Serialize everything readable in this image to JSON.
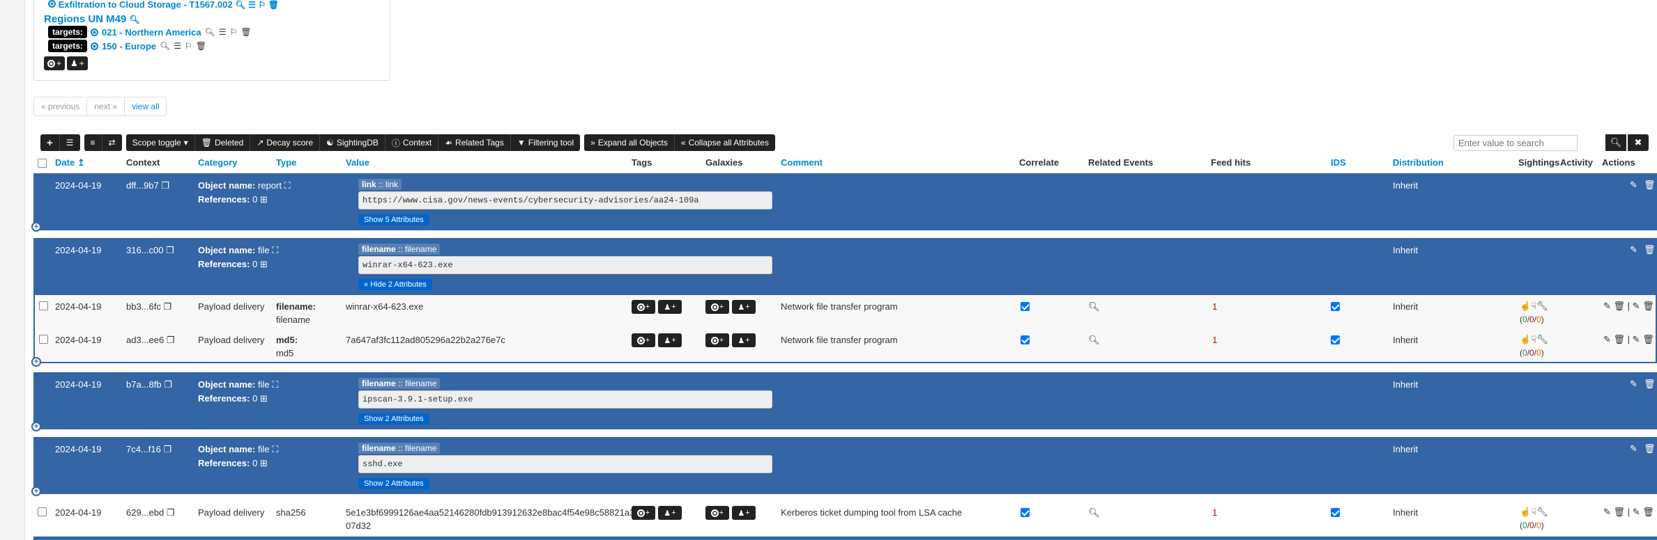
{
  "galaxy_box": {
    "cut_line": "Exfiltration to Cloud Storage - T1567.002",
    "title": "Regions UN M49",
    "targets_label": "targets:",
    "targets": [
      {
        "name": "021 - Northern America"
      },
      {
        "name": "150 - Europe"
      }
    ]
  },
  "pagination": {
    "prev": "« previous",
    "next": "next »",
    "view_all": "view all"
  },
  "toolbar": {
    "scope_toggle": "Scope toggle",
    "deleted": "Deleted",
    "decay_score": "Decay score",
    "sightingdb": "SightingDB",
    "context": "Context",
    "related_tags": "Related Tags",
    "filtering_tool": "Filtering tool",
    "expand_all": "Expand all Objects",
    "collapse_all": "Collapse all Attributes"
  },
  "search": {
    "placeholder": "Enter value to search"
  },
  "columns": {
    "date": "Date",
    "context": "Context",
    "category": "Category",
    "type": "Type",
    "value": "Value",
    "tags": "Tags",
    "galaxies": "Galaxies",
    "comment": "Comment",
    "correlate": "Correlate",
    "related_events": "Related Events",
    "feed_hits": "Feed hits",
    "ids": "IDS",
    "distribution": "Distribution",
    "sightings": "Sightings",
    "activity": "Activity",
    "actions": "Actions"
  },
  "objects": [
    {
      "date": "2024-04-19",
      "uuid": "dff...9b7",
      "object_name_label": "Object name:",
      "object_name": "report",
      "references_label": "References:",
      "references": "0",
      "rel_name": "link",
      "rel_sep": " :: ",
      "rel_type": "link",
      "value": "https://www.cisa.gov/news-events/cybersecurity-advisories/aa24-109a",
      "toggle": "Show 5 Attributes",
      "distribution": "Inherit"
    },
    {
      "date": "2024-04-19",
      "uuid": "316...c00",
      "object_name_label": "Object name:",
      "object_name": "file",
      "references_label": "References:",
      "references": "0",
      "rel_name": "filename",
      "rel_sep": " :: ",
      "rel_type": "filename",
      "value": "winrar-x64-623.exe",
      "toggle": "Hide 2 Attributes",
      "distribution": "Inherit"
    },
    {
      "date": "2024-04-19",
      "uuid": "b7a...8fb",
      "object_name_label": "Object name:",
      "object_name": "file",
      "references_label": "References:",
      "references": "0",
      "rel_name": "filename",
      "rel_sep": " :: ",
      "rel_type": "filename",
      "value": "ipscan-3.9.1-setup.exe",
      "toggle": "Show 2 Attributes",
      "distribution": "Inherit"
    },
    {
      "date": "2024-04-19",
      "uuid": "7c4...f16",
      "object_name_label": "Object name:",
      "object_name": "file",
      "references_label": "References:",
      "references": "0",
      "rel_name": "filename",
      "rel_sep": " :: ",
      "rel_type": "filename",
      "value": "sshd.exe",
      "toggle": "Show 2 Attributes",
      "distribution": "Inherit"
    }
  ],
  "attributes": [
    {
      "date": "2024-04-19",
      "uuid": "bb3...6fc",
      "category": "Payload delivery",
      "type_rel": "filename:",
      "type": "filename",
      "value": "winrar-x64-623.exe",
      "comment": "Network file transfer program",
      "feed_hits": "1",
      "distribution": "Inherit",
      "sightings_open": "(",
      "s_pos": "0",
      "slash1": "/",
      "s_neg": "0",
      "slash2": "/",
      "s_exp": "0",
      "sightings_close": ")"
    },
    {
      "date": "2024-04-19",
      "uuid": "ad3...ee6",
      "category": "Payload delivery",
      "type_rel": "md5:",
      "type": "md5",
      "value": "7a647af3fc112ad805296a22b2a276e7c",
      "comment": "Network file transfer program",
      "feed_hits": "1",
      "distribution": "Inherit",
      "sightings_open": "(",
      "s_pos": "0",
      "slash1": "/",
      "s_neg": "0",
      "slash2": "/",
      "s_exp": "0",
      "sightings_close": ")"
    },
    {
      "date": "2024-04-19",
      "uuid": "629...ebd",
      "category": "Payload delivery",
      "type": "sha256",
      "value_line1": "5e1e3bf6999126ae4aa52146280fdb913912632e8bac4f54e98c58821a3",
      "value_line2": "07d32",
      "comment": "Kerberos ticket dumping tool from LSA cache",
      "feed_hits": "1",
      "distribution": "Inherit",
      "sightings_open": "(",
      "s_pos": "0",
      "slash1": "/",
      "s_neg": "0",
      "slash2": "/",
      "s_exp": "0",
      "sightings_close": ")"
    }
  ],
  "colors": {
    "object_row": "#3465a4",
    "link": "#0088cc",
    "toolbar": "#222222",
    "feed_hit": "#cc0000"
  }
}
